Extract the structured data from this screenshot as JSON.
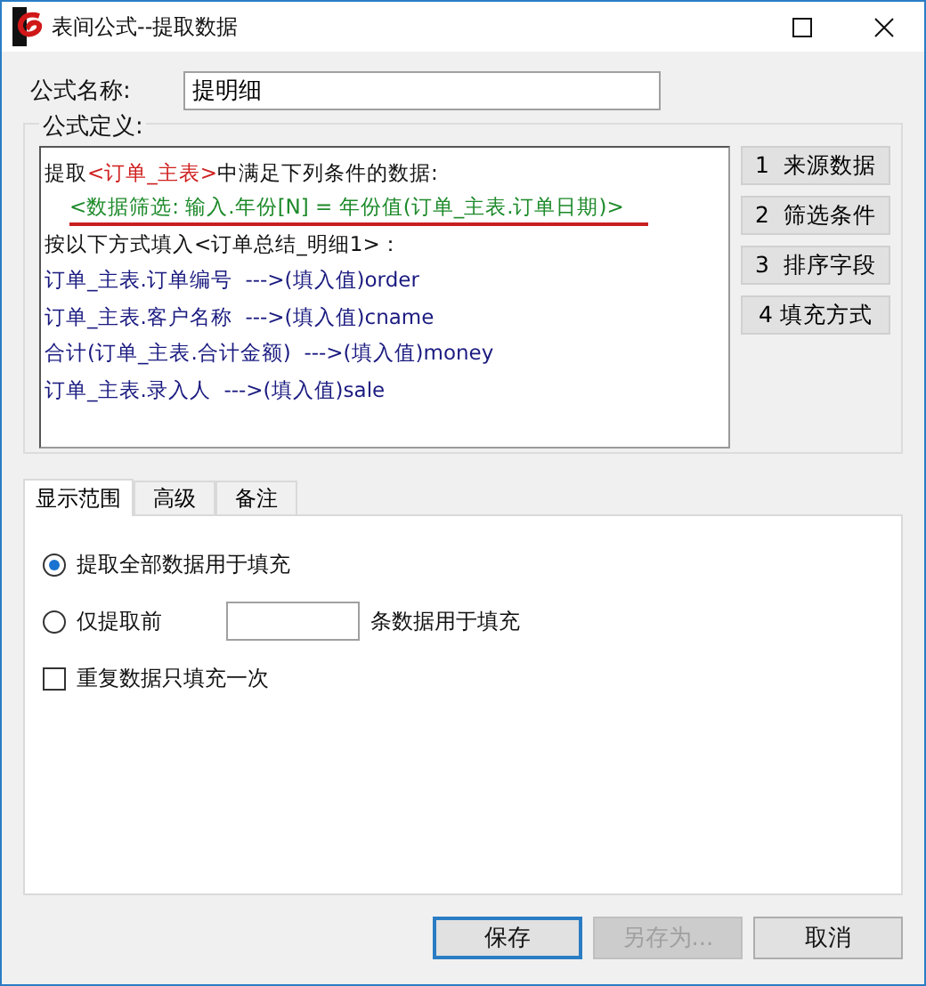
{
  "window": {
    "title": "表间公式--提取数据"
  },
  "name_field": {
    "label": "公式名称:",
    "value": "提明细"
  },
  "definition": {
    "label": "公式定义:",
    "lines": [
      {
        "underlined": false,
        "segments": [
          {
            "text": "提取",
            "kind": "plain"
          },
          {
            "text": "<订单_主表>",
            "kind": "table"
          },
          {
            "text": "中满足下列条件的数据:",
            "kind": "plain"
          }
        ]
      },
      {
        "underlined": true,
        "segments": [
          {
            "text": "<数据筛选: 输入.年份[N] = 年份值(订单_主表.订单日期)>",
            "kind": "filter"
          }
        ]
      },
      {
        "underlined": false,
        "segments": [
          {
            "text": "按以下方式填入<订单总结_明细1>：",
            "kind": "plain"
          }
        ]
      },
      {
        "underlined": false,
        "segments": [
          {
            "text": "订单_主表.订单编号  --->(填入值)order",
            "kind": "field"
          }
        ]
      },
      {
        "underlined": false,
        "segments": [
          {
            "text": "订单_主表.客户名称  --->(填入值)cname",
            "kind": "field"
          }
        ]
      },
      {
        "underlined": false,
        "segments": [
          {
            "text": "合计(订单_主表.合计金额)  --->(填入值)money",
            "kind": "field"
          }
        ]
      },
      {
        "underlined": false,
        "segments": [
          {
            "text": "订单_主表.录入人  --->(填入值)sale",
            "kind": "field"
          }
        ]
      }
    ],
    "buttons": [
      "1  来源数据",
      "2  筛选条件",
      "3  排序字段",
      "4 填充方式"
    ]
  },
  "tabs": [
    {
      "label": "显示范围",
      "selected": true
    },
    {
      "label": "高级",
      "selected": false
    },
    {
      "label": "备注",
      "selected": false
    }
  ],
  "options": [
    {
      "kind": "radio",
      "label": "提取全部数据用于填充",
      "selected": true
    },
    {
      "kind": "radio-count",
      "label": "仅提取前",
      "suffix": "条数据用于填充",
      "selected": false
    },
    {
      "kind": "checkbox",
      "label": "重复数据只填充一次",
      "checked": false
    }
  ],
  "footer_buttons": [
    {
      "label": "保存",
      "default": true,
      "disabled": false
    },
    {
      "label": "另存为...",
      "default": false,
      "disabled": true
    },
    {
      "label": "取消",
      "default": false,
      "disabled": false
    }
  ]
}
